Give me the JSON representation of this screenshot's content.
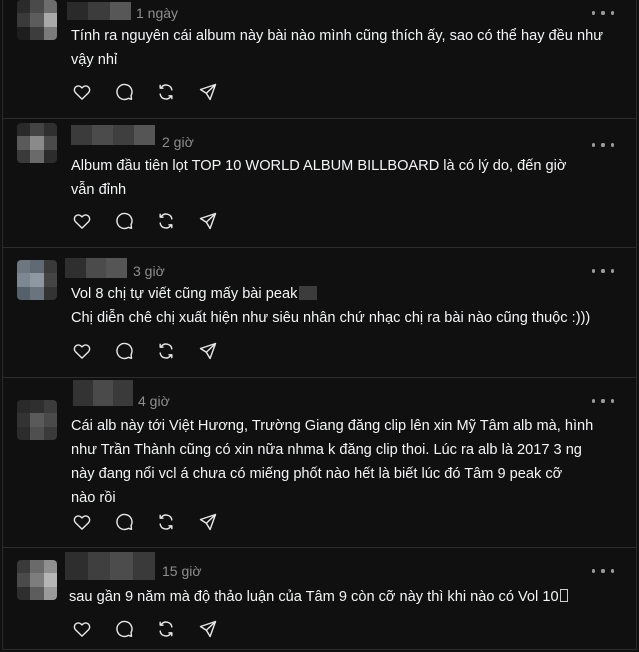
{
  "posts": [
    {
      "time": "1 ngày",
      "text": [
        "Tính ra nguyên cái album này bài nào mình cũng thích ấy, sao có thể hay đều như",
        "vậy nhỉ"
      ]
    },
    {
      "time": "2 giờ",
      "text": [
        "Album đầu tiên lọt TOP 10 WORLD ALBUM BILLBOARD là có lý do, đến giờ",
        "vẫn đỉnh"
      ]
    },
    {
      "time": "3 giờ",
      "text": [
        "Vol 8 chị tự viết cũng mấy bài peak",
        "Chị diễn chê chị xuất hiện như siêu nhân chứ nhạc chị ra bài nào cũng thuộc :)))"
      ]
    },
    {
      "time": "4 giờ",
      "text": [
        "Cái alb này tới Việt Hương, Trường Giang đăng clip lên xin Mỹ Tâm alb mà, hình",
        "như Trần Thành cũng có xin nữa nhma k đăng clip thoi. Lúc ra alb là 2017 3 ng",
        "này đang nổi vcl á chưa có miếng phốt nào hết là biết lúc đó Tâm 9 peak cỡ",
        "nào rồi"
      ]
    },
    {
      "time": "15 giờ",
      "text": [
        "sau gần 9 năm mà độ thảo luận của Tâm 9 còn cỡ này thì khi nào có Vol 10"
      ]
    }
  ],
  "icons": {
    "like": "heart-icon",
    "reply": "comment-icon",
    "repost": "repost-icon",
    "share": "send-icon",
    "menu": "more-icon"
  },
  "colors": {
    "background": "#101010",
    "text": "#f3f5f7",
    "muted": "#8e8e8e",
    "divider": "#2c2c2c"
  }
}
